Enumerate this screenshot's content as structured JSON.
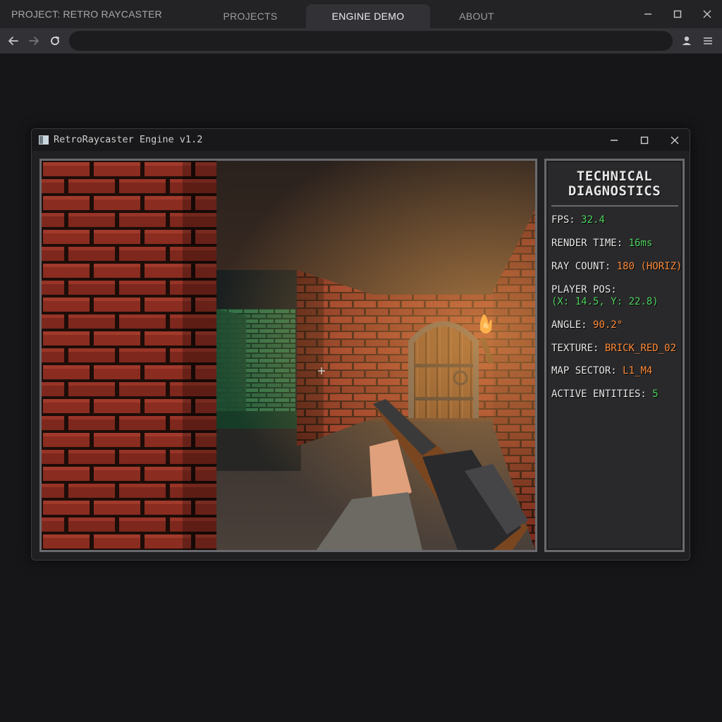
{
  "browser": {
    "project_title": "PROJECT: RETRO RAYCASTER",
    "tabs": [
      {
        "label": "PROJECTS",
        "active": false
      },
      {
        "label": "ENGINE DEMO",
        "active": true
      },
      {
        "label": "ABOUT",
        "active": false
      }
    ],
    "address_value": "",
    "icons": {
      "back": "back-arrow-icon",
      "forward": "forward-arrow-icon",
      "reload": "reload-icon",
      "profile": "profile-icon",
      "menu": "menu-icon",
      "minimize": "minimize-icon",
      "maximize": "maximize-icon",
      "close": "close-icon"
    }
  },
  "app": {
    "title": "RetroRaycaster Engine v1.2",
    "controls": {
      "minimize": "—",
      "maximize": "☐",
      "close": "✕"
    }
  },
  "diagnostics": {
    "title_line1": "TECHNICAL",
    "title_line2": "DIAGNOSTICS",
    "stats": {
      "fps_label": "FPS:",
      "fps_value": "32.4",
      "render_label": "RENDER TIME:",
      "render_value": "16ms",
      "ray_label": "RAY COUNT:",
      "ray_value": "180 (HORIZ)",
      "pos_label": "PLAYER POS:",
      "pos_value": "(X: 14.5, Y: 22.8)",
      "angle_label": "ANGLE:",
      "angle_value": "90.2°",
      "texture_label": "TEXTURE:",
      "texture_value": "BRICK_RED_02",
      "sector_label": "MAP SECTOR:",
      "sector_value": "L1_M4",
      "entities_label": "ACTIVE ENTITIES:",
      "entities_value": "5"
    }
  },
  "colors": {
    "value_green": "#4fd35f",
    "value_orange": "#ff8c3a",
    "brick_red": "#8e2f22",
    "brick_green": "#2f6d45"
  }
}
